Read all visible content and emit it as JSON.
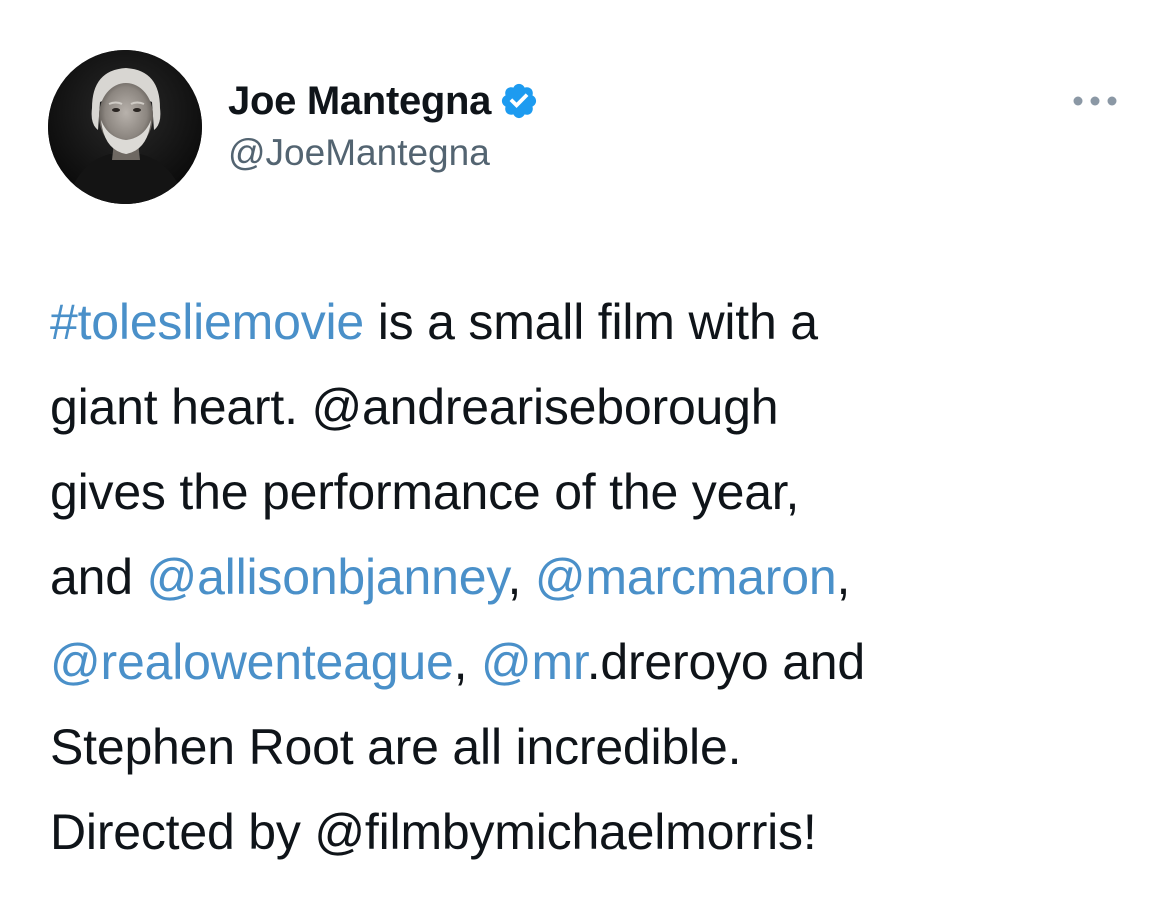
{
  "author": {
    "display_name": "Joe Mantegna",
    "handle": "@JoeMantegna",
    "verified_icon": "verified-badge-icon",
    "avatar_icon": "profile-photo"
  },
  "more_menu_icon": "more-options-icon",
  "colors": {
    "link": "#4a90c9",
    "text": "#0f1419",
    "secondary_text": "#536471",
    "verified": "#1d9bf0",
    "background": "#ffffff"
  },
  "tweet": {
    "lines": [
      [
        {
          "text": "#toleslie",
          "link": true
        },
        {
          "text": "movie",
          "link": true
        },
        {
          "text": " is a small film with a",
          "link": false
        }
      ],
      [
        {
          "text": "giant heart. @andreariseborough",
          "link": false
        }
      ],
      [
        {
          "text": "gives the performance of the year,",
          "link": false
        }
      ],
      [
        {
          "text": "and ",
          "link": false
        },
        {
          "text": "@allisonbjanney",
          "link": true
        },
        {
          "text": ", ",
          "link": false
        },
        {
          "text": "@marcmaron",
          "link": true
        },
        {
          "text": ",",
          "link": false
        }
      ],
      [
        {
          "text": "@realowenteague",
          "link": true
        },
        {
          "text": ", ",
          "link": false
        },
        {
          "text": "@mr",
          "link": true
        },
        {
          "text": ".dreroyo and",
          "link": false
        }
      ],
      [
        {
          "text": "Stephen Root are all incredible.",
          "link": false
        }
      ],
      [
        {
          "text": "Directed by @filmbymichaelmorris!",
          "link": false
        }
      ]
    ]
  }
}
